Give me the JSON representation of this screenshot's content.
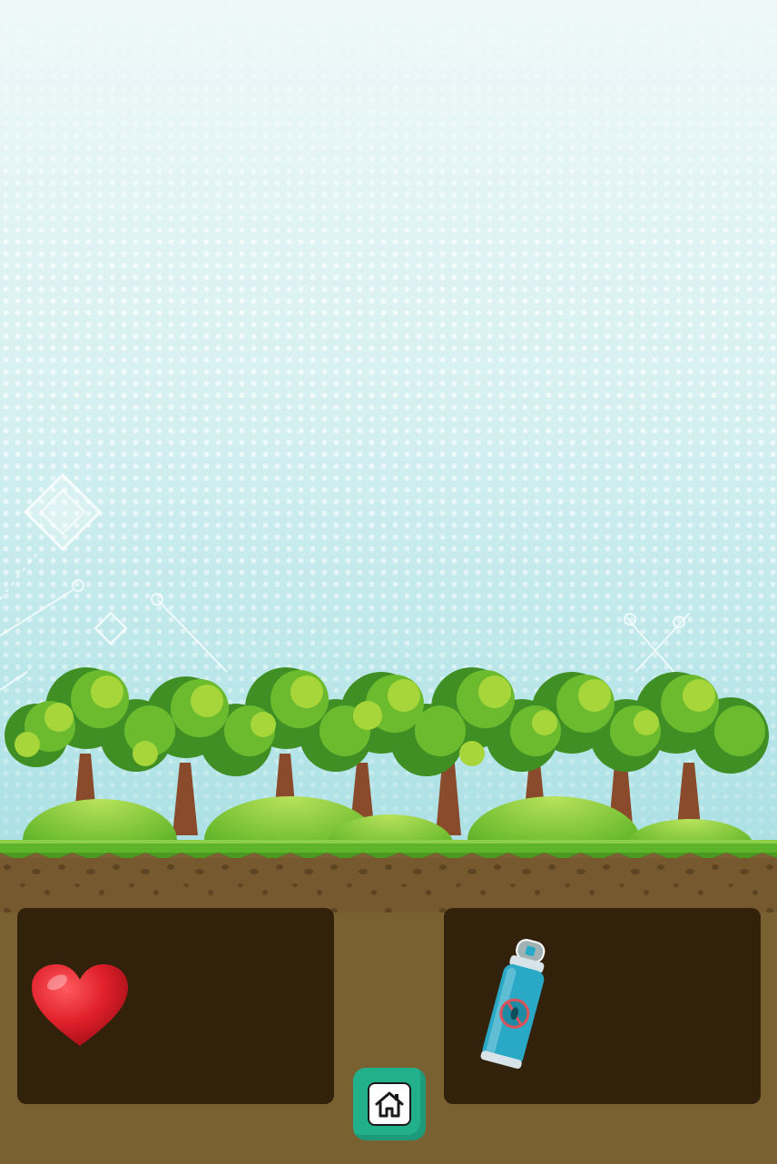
{
  "scene": {
    "name": "garden-level",
    "background": {
      "sky_color_top": "#eef8f8",
      "sky_color_bottom": "#9fdbe0",
      "tree_light": "#a6d63a",
      "tree_mid": "#6cbb2f",
      "tree_dark": "#3f8f24",
      "trunk": "#8a4a2c",
      "ground": "#7a6132",
      "panel": "#32220b"
    },
    "inventory_left": {
      "item_icon": "heart-icon",
      "item_color": "#e0202b"
    },
    "inventory_right": {
      "item_icon": "insect-spray-can-icon",
      "item_color": "#2aa9c6"
    },
    "home_button": {
      "icon": "home-icon",
      "color": "#22b08a"
    }
  }
}
